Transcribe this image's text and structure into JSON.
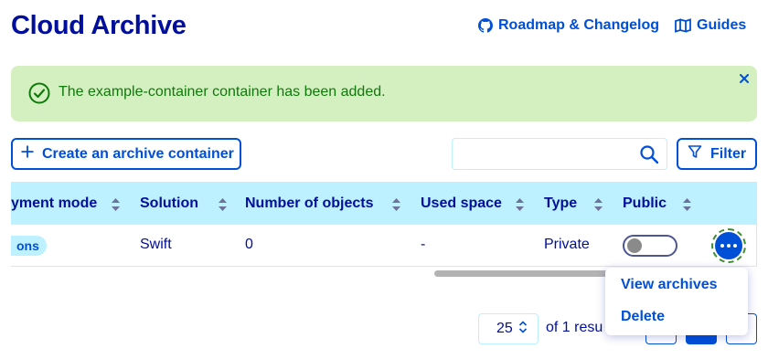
{
  "header": {
    "title": "Cloud Archive",
    "roadmap_link": "Roadmap & Changelog",
    "guides_link": "Guides"
  },
  "alert": {
    "message": "The example-container container has been added.",
    "status_color": "#0e7a09"
  },
  "toolbar": {
    "create_label": "Create an archive container",
    "search_value": "",
    "filter_label": "Filter"
  },
  "table": {
    "columns": [
      "yment mode",
      "Solution",
      "Number of objects",
      "Used space",
      "Type",
      "Public"
    ],
    "rows": [
      {
        "deployment_mode": "ons",
        "solution": "Swift",
        "number_of_objects": "0",
        "used_space": "-",
        "type": "Private",
        "public": false
      }
    ]
  },
  "action_menu": {
    "items": [
      "View archives",
      "Delete"
    ]
  },
  "pagination": {
    "page_size": "25",
    "results_text": "of 1 resu"
  },
  "colors": {
    "primary": "#0050d7",
    "title": "#000e9c",
    "header_bg": "#bef1ff",
    "alert_bg": "#d4f0c1"
  }
}
